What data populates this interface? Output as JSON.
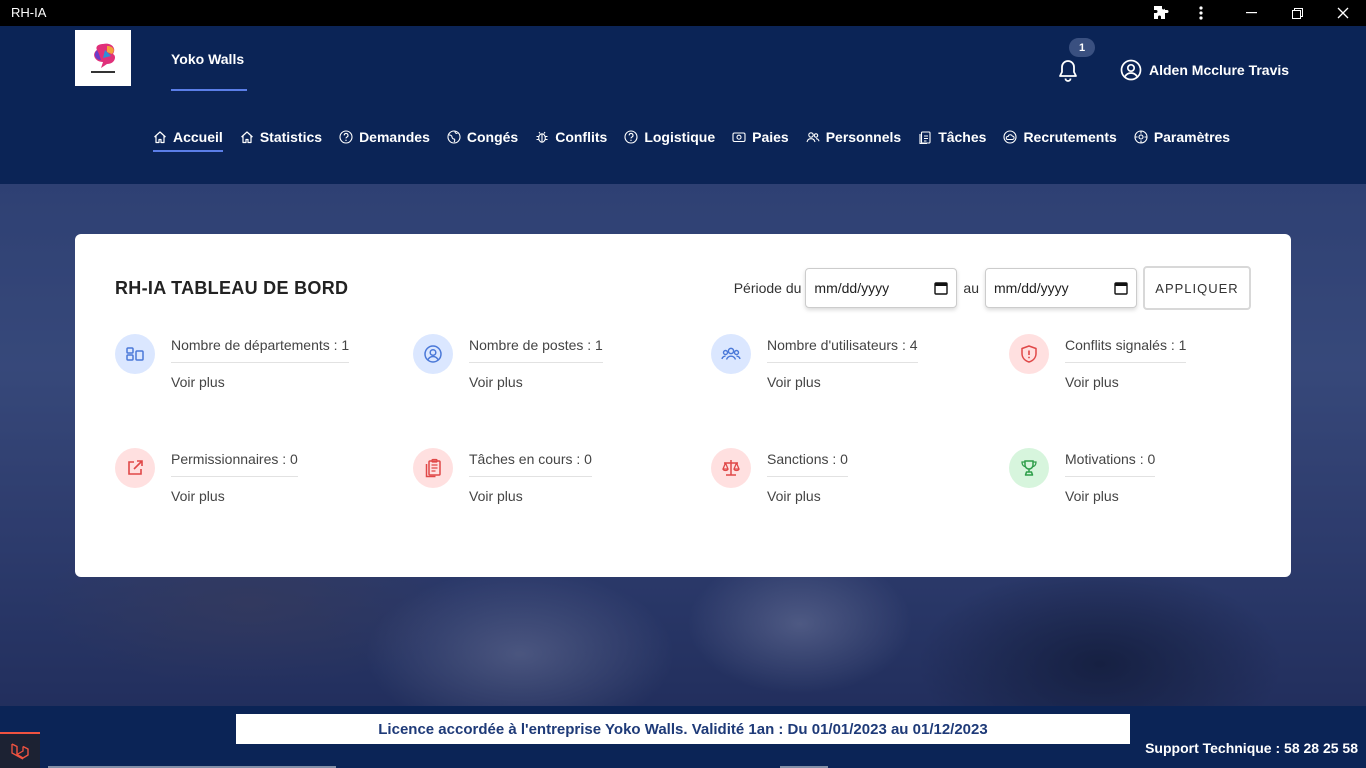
{
  "window": {
    "title": "RH-IA"
  },
  "header": {
    "company": "Yoko Walls",
    "notifications_count": "1",
    "user_name": "Alden Mcclure Travis"
  },
  "nav": [
    {
      "label": "Accueil",
      "icon": "home-icon",
      "active": true
    },
    {
      "label": "Statistics",
      "icon": "home-icon"
    },
    {
      "label": "Demandes",
      "icon": "question-circle-icon"
    },
    {
      "label": "Congés",
      "icon": "globe-icon"
    },
    {
      "label": "Conflits",
      "icon": "bug-icon"
    },
    {
      "label": "Logistique",
      "icon": "question-circle-icon"
    },
    {
      "label": "Paies",
      "icon": "money-icon"
    },
    {
      "label": "Personnels",
      "icon": "users-icon"
    },
    {
      "label": "Tâches",
      "icon": "clipboard-icon"
    },
    {
      "label": "Recrutements",
      "icon": "cloud-upload-icon"
    },
    {
      "label": "Paramètres",
      "icon": "gear-icon"
    }
  ],
  "dashboard": {
    "title": "RH-IA TABLEAU DE BORD",
    "period_label": "Période du",
    "to_label": "au",
    "date_placeholder": "mm/dd/yyyy",
    "apply_label": "APPLIQUER",
    "stats": [
      {
        "label": "Nombre de départements : 1",
        "more": "Voir plus",
        "icon": "departments-icon",
        "color": "blue"
      },
      {
        "label": "Nombre de postes : 1",
        "more": "Voir plus",
        "icon": "user-circle-icon",
        "color": "blue"
      },
      {
        "label": "Nombre d'utilisateurs : 4",
        "more": "Voir plus",
        "icon": "users-group-icon",
        "color": "blue"
      },
      {
        "label": "Conflits signalés : 1",
        "more": "Voir plus",
        "icon": "shield-alert-icon",
        "color": "red"
      },
      {
        "label": "Permissionnaires : 0",
        "more": "Voir plus",
        "icon": "external-link-icon",
        "color": "red"
      },
      {
        "label": "Tâches en cours : 0",
        "more": "Voir plus",
        "icon": "clipboard-icon",
        "color": "red"
      },
      {
        "label": "Sanctions : 0",
        "more": "Voir plus",
        "icon": "scale-icon",
        "color": "red"
      },
      {
        "label": "Motivations : 0",
        "more": "Voir plus",
        "icon": "trophy-icon",
        "color": "green"
      }
    ]
  },
  "footer": {
    "license": "Licence accordée à l'entreprise Yoko Walls. Validité 1an : Du 01/01/2023 au 01/12/2023",
    "support": "Support Technique :  58 28 25 58"
  },
  "colors": {
    "navy": "#0b2456",
    "accent": "#5b7ee8",
    "blue_icon": "#4a78d8",
    "red_icon": "#e04848",
    "green_icon": "#2e9e4a"
  }
}
